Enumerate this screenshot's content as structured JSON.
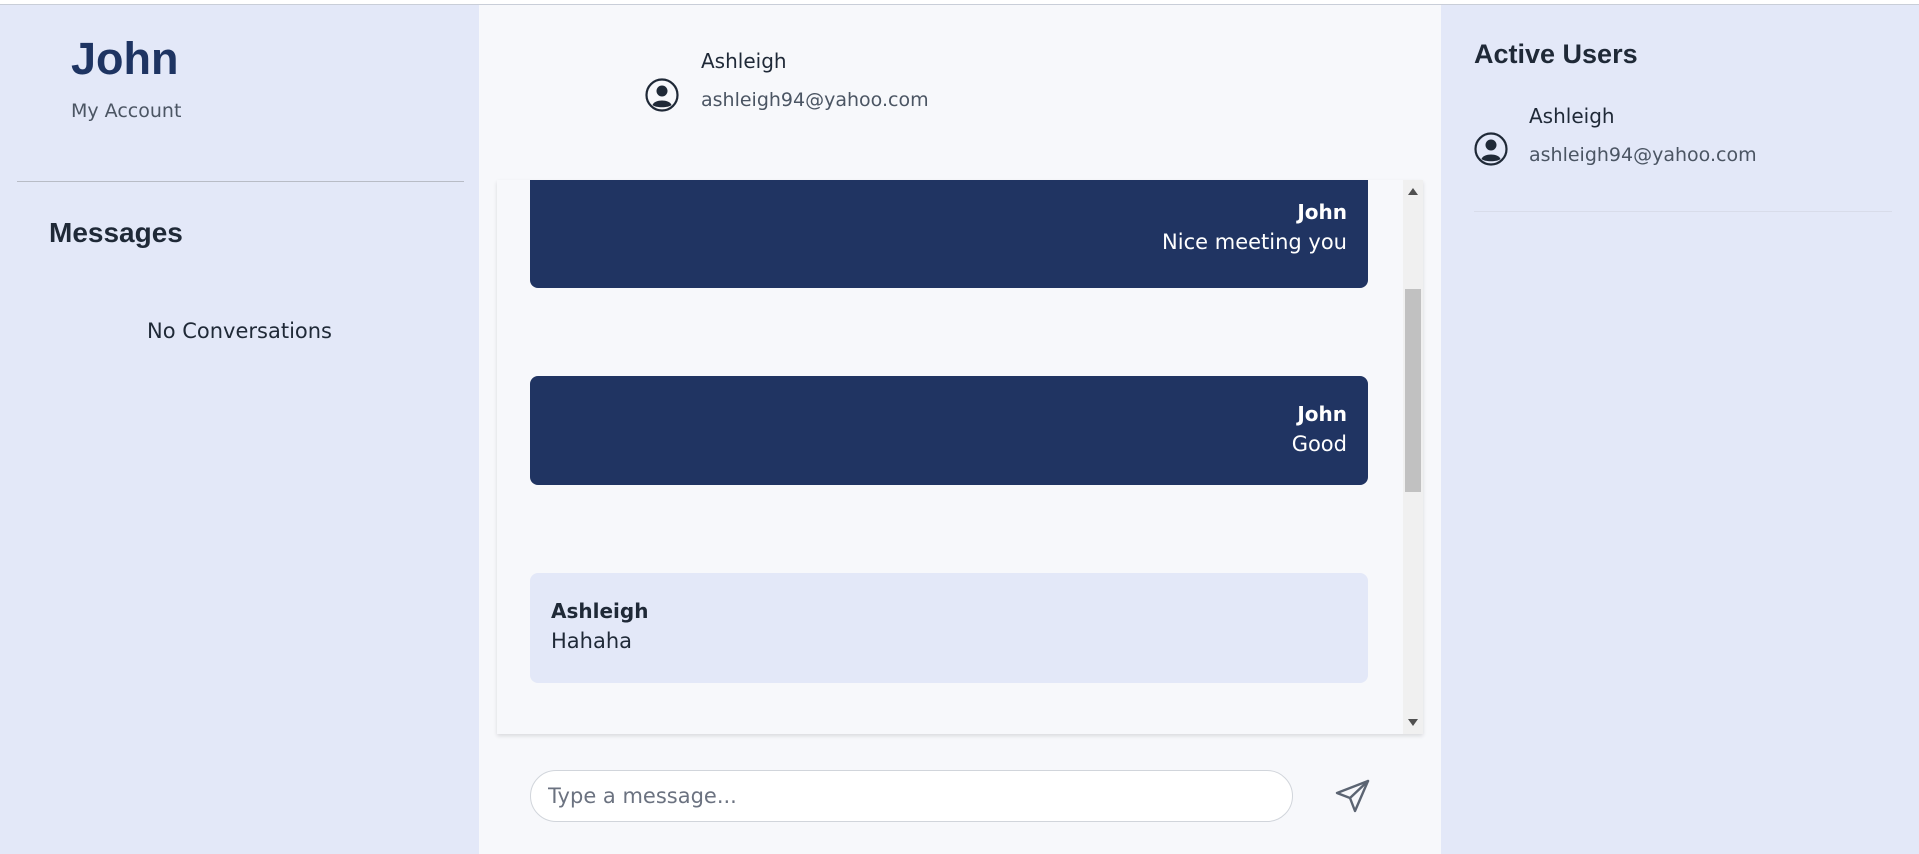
{
  "account": {
    "name": "John",
    "link_label": "My Account"
  },
  "messages_sidebar": {
    "title": "Messages",
    "empty_text": "No Conversations"
  },
  "chat": {
    "contact_name": "Ashleigh",
    "contact_email": "ashleigh94@yahoo.com",
    "messages": [
      {
        "sender": "John",
        "text": "Nice meeting you",
        "direction": "sent"
      },
      {
        "sender": "John",
        "text": "Good",
        "direction": "sent"
      },
      {
        "sender": "Ashleigh",
        "text": "Hahaha",
        "direction": "received"
      }
    ],
    "input_placeholder": "Type a message...",
    "send_icon": "send-icon"
  },
  "active_users": {
    "title": "Active Users",
    "users": [
      {
        "name": "Ashleigh",
        "email": "ashleigh94@yahoo.com",
        "icon": "user-circle-icon"
      }
    ]
  },
  "colors": {
    "sidebar_bg": "#e3e8f8",
    "chat_bg": "#f7f8fb",
    "sent_bubble": "#203462",
    "received_bubble": "#e3e8f8",
    "title_accent": "#1e3462"
  }
}
